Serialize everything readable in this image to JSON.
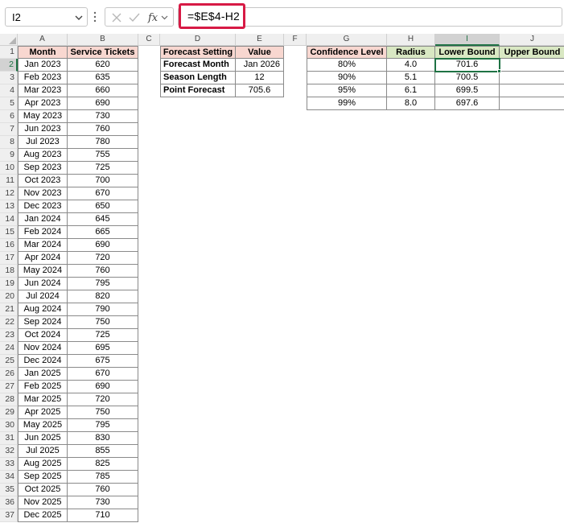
{
  "name_box": {
    "value": "I2"
  },
  "formula_bar": {
    "formula": "=$E$4-H2"
  },
  "icons": {
    "cancel": "x-icon",
    "enter": "check-icon",
    "function": "fx-icon"
  },
  "colors": {
    "accent_green": "#1f7244",
    "header_pink": "#f8d7d0",
    "header_green": "#d9e8c3",
    "highlight_red": "#d71a45"
  },
  "columns": [
    "A",
    "B",
    "C",
    "D",
    "E",
    "F",
    "G",
    "H",
    "I",
    "J"
  ],
  "rows": [
    "1",
    "2",
    "3",
    "4",
    "5",
    "6",
    "7",
    "8",
    "9",
    "10",
    "11",
    "12",
    "13",
    "14",
    "15",
    "16",
    "17",
    "18",
    "19",
    "20",
    "21",
    "22",
    "23",
    "24",
    "25",
    "26",
    "27",
    "28",
    "29",
    "30",
    "31",
    "32",
    "33",
    "34",
    "35",
    "36",
    "37"
  ],
  "table_a": {
    "headers": [
      "Month",
      "Service Tickets"
    ],
    "rows": [
      [
        "Jan 2023",
        "620"
      ],
      [
        "Feb 2023",
        "635"
      ],
      [
        "Mar 2023",
        "660"
      ],
      [
        "Apr 2023",
        "690"
      ],
      [
        "May 2023",
        "730"
      ],
      [
        "Jun 2023",
        "760"
      ],
      [
        "Jul 2023",
        "780"
      ],
      [
        "Aug 2023",
        "755"
      ],
      [
        "Sep 2023",
        "725"
      ],
      [
        "Oct 2023",
        "700"
      ],
      [
        "Nov 2023",
        "670"
      ],
      [
        "Dec 2023",
        "650"
      ],
      [
        "Jan 2024",
        "645"
      ],
      [
        "Feb 2024",
        "665"
      ],
      [
        "Mar 2024",
        "690"
      ],
      [
        "Apr 2024",
        "720"
      ],
      [
        "May 2024",
        "760"
      ],
      [
        "Jun 2024",
        "795"
      ],
      [
        "Jul 2024",
        "820"
      ],
      [
        "Aug 2024",
        "790"
      ],
      [
        "Sep 2024",
        "750"
      ],
      [
        "Oct 2024",
        "725"
      ],
      [
        "Nov 2024",
        "695"
      ],
      [
        "Dec 2024",
        "675"
      ],
      [
        "Jan 2025",
        "670"
      ],
      [
        "Feb 2025",
        "690"
      ],
      [
        "Mar 2025",
        "720"
      ],
      [
        "Apr 2025",
        "750"
      ],
      [
        "May 2025",
        "795"
      ],
      [
        "Jun 2025",
        "830"
      ],
      [
        "Jul 2025",
        "855"
      ],
      [
        "Aug 2025",
        "825"
      ],
      [
        "Sep 2025",
        "785"
      ],
      [
        "Oct 2025",
        "760"
      ],
      [
        "Nov 2025",
        "730"
      ],
      [
        "Dec 2025",
        "710"
      ]
    ]
  },
  "table_d": {
    "headers": [
      "Forecast Setting",
      "Value"
    ],
    "rows": [
      [
        "Forecast Month",
        "Jan 2026"
      ],
      [
        "Season Length",
        "12"
      ],
      [
        "Point Forecast",
        "705.6"
      ]
    ]
  },
  "table_g": {
    "headers": [
      "Confidence Level",
      "Radius",
      "Lower Bound",
      "Upper Bound"
    ],
    "rows": [
      [
        "80%",
        "4.0",
        "701.6",
        ""
      ],
      [
        "90%",
        "5.1",
        "700.5",
        ""
      ],
      [
        "95%",
        "6.1",
        "699.5",
        ""
      ],
      [
        "99%",
        "8.0",
        "697.6",
        ""
      ]
    ]
  }
}
